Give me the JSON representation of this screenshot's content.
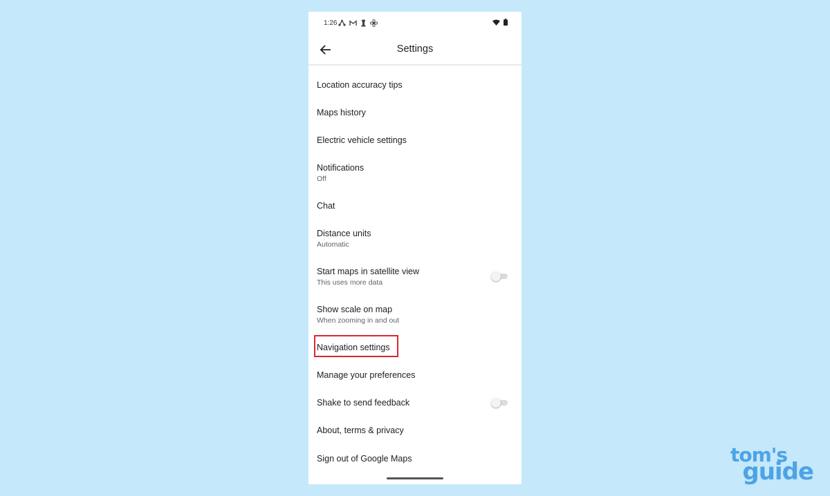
{
  "status_bar": {
    "time": "1:26",
    "left_icons": [
      "maps-transit-icon",
      "gmail-icon",
      "accessibility-icon",
      "fan-icon"
    ],
    "right_icons": [
      "wifi-icon",
      "battery-icon"
    ]
  },
  "app_bar": {
    "title": "Settings",
    "back_icon": "arrow-left-icon"
  },
  "settings_items": [
    {
      "title": "Location accuracy tips"
    },
    {
      "title": "Maps history"
    },
    {
      "title": "Electric vehicle settings"
    },
    {
      "title": "Notifications",
      "subtitle": "Off"
    },
    {
      "title": "Chat"
    },
    {
      "title": "Distance units",
      "subtitle": "Automatic"
    },
    {
      "title": "Start maps in satellite view",
      "subtitle": "This uses more data",
      "toggle": "off"
    },
    {
      "title": "Show scale on map",
      "subtitle": "When zooming in and out"
    },
    {
      "title": "Navigation settings",
      "highlighted": true
    },
    {
      "title": "Manage your preferences"
    },
    {
      "title": "Shake to send feedback",
      "toggle": "off"
    },
    {
      "title": "About, terms & privacy"
    },
    {
      "title": "Sign out of Google Maps"
    }
  ],
  "highlight_color": "#d9272e",
  "background_color": "#c5e8fa",
  "watermark": {
    "line1": "tom's",
    "line2": "guide"
  }
}
